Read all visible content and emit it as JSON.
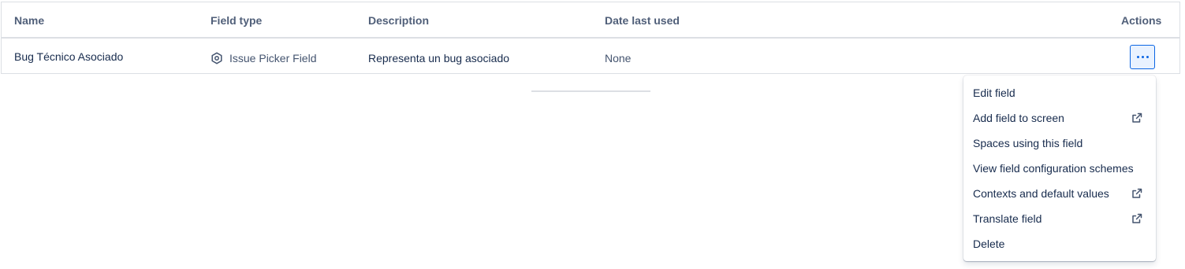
{
  "table": {
    "headers": {
      "name": "Name",
      "field_type": "Field type",
      "description": "Description",
      "date_last_used": "Date last used",
      "actions": "Actions"
    },
    "rows": [
      {
        "name": "Bug Técnico Asociado",
        "field_type": "Issue Picker Field",
        "field_type_icon": "hexagon-gear-icon",
        "description": "Representa un bug asociado",
        "date_last_used": "None",
        "actions_icon": "more-horizontal-icon"
      }
    ]
  },
  "menu": {
    "items": [
      {
        "label": "Edit field",
        "external": false
      },
      {
        "label": "Add field to screen",
        "external": true
      },
      {
        "label": "Spaces using this field",
        "external": false
      },
      {
        "label": "View field configuration schemes",
        "external": false
      },
      {
        "label": "Contexts and default values",
        "external": true
      },
      {
        "label": "Translate field",
        "external": true
      },
      {
        "label": "Delete",
        "external": false
      }
    ]
  },
  "colors": {
    "accent": "#0c66e4",
    "header_text": "#505f79",
    "border": "#dcdfe4"
  }
}
